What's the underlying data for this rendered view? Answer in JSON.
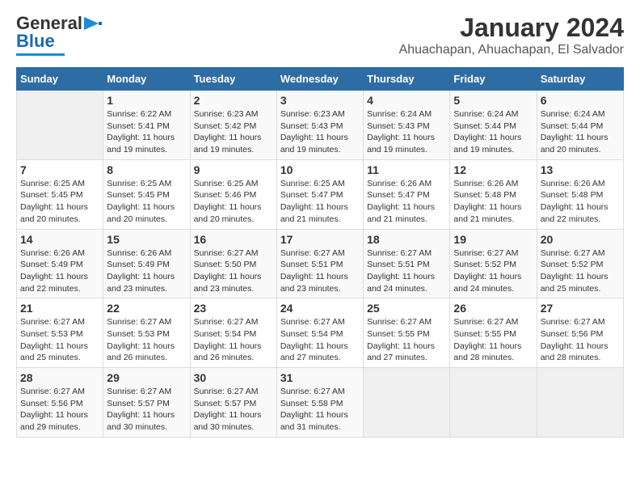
{
  "header": {
    "logo_line1": "General",
    "logo_line2": "Blue",
    "title": "January 2024",
    "subtitle": "Ahuachapan, Ahuachapan, El Salvador"
  },
  "days_of_week": [
    "Sunday",
    "Monday",
    "Tuesday",
    "Wednesday",
    "Thursday",
    "Friday",
    "Saturday"
  ],
  "weeks": [
    [
      {
        "day": "",
        "info": ""
      },
      {
        "day": "1",
        "info": "Sunrise: 6:22 AM\nSunset: 5:41 PM\nDaylight: 11 hours\nand 19 minutes."
      },
      {
        "day": "2",
        "info": "Sunrise: 6:23 AM\nSunset: 5:42 PM\nDaylight: 11 hours\nand 19 minutes."
      },
      {
        "day": "3",
        "info": "Sunrise: 6:23 AM\nSunset: 5:43 PM\nDaylight: 11 hours\nand 19 minutes."
      },
      {
        "day": "4",
        "info": "Sunrise: 6:24 AM\nSunset: 5:43 PM\nDaylight: 11 hours\nand 19 minutes."
      },
      {
        "day": "5",
        "info": "Sunrise: 6:24 AM\nSunset: 5:44 PM\nDaylight: 11 hours\nand 19 minutes."
      },
      {
        "day": "6",
        "info": "Sunrise: 6:24 AM\nSunset: 5:44 PM\nDaylight: 11 hours\nand 20 minutes."
      }
    ],
    [
      {
        "day": "7",
        "info": "Sunrise: 6:25 AM\nSunset: 5:45 PM\nDaylight: 11 hours\nand 20 minutes."
      },
      {
        "day": "8",
        "info": "Sunrise: 6:25 AM\nSunset: 5:45 PM\nDaylight: 11 hours\nand 20 minutes."
      },
      {
        "day": "9",
        "info": "Sunrise: 6:25 AM\nSunset: 5:46 PM\nDaylight: 11 hours\nand 20 minutes."
      },
      {
        "day": "10",
        "info": "Sunrise: 6:25 AM\nSunset: 5:47 PM\nDaylight: 11 hours\nand 21 minutes."
      },
      {
        "day": "11",
        "info": "Sunrise: 6:26 AM\nSunset: 5:47 PM\nDaylight: 11 hours\nand 21 minutes."
      },
      {
        "day": "12",
        "info": "Sunrise: 6:26 AM\nSunset: 5:48 PM\nDaylight: 11 hours\nand 21 minutes."
      },
      {
        "day": "13",
        "info": "Sunrise: 6:26 AM\nSunset: 5:48 PM\nDaylight: 11 hours\nand 22 minutes."
      }
    ],
    [
      {
        "day": "14",
        "info": "Sunrise: 6:26 AM\nSunset: 5:49 PM\nDaylight: 11 hours\nand 22 minutes."
      },
      {
        "day": "15",
        "info": "Sunrise: 6:26 AM\nSunset: 5:49 PM\nDaylight: 11 hours\nand 23 minutes."
      },
      {
        "day": "16",
        "info": "Sunrise: 6:27 AM\nSunset: 5:50 PM\nDaylight: 11 hours\nand 23 minutes."
      },
      {
        "day": "17",
        "info": "Sunrise: 6:27 AM\nSunset: 5:51 PM\nDaylight: 11 hours\nand 23 minutes."
      },
      {
        "day": "18",
        "info": "Sunrise: 6:27 AM\nSunset: 5:51 PM\nDaylight: 11 hours\nand 24 minutes."
      },
      {
        "day": "19",
        "info": "Sunrise: 6:27 AM\nSunset: 5:52 PM\nDaylight: 11 hours\nand 24 minutes."
      },
      {
        "day": "20",
        "info": "Sunrise: 6:27 AM\nSunset: 5:52 PM\nDaylight: 11 hours\nand 25 minutes."
      }
    ],
    [
      {
        "day": "21",
        "info": "Sunrise: 6:27 AM\nSunset: 5:53 PM\nDaylight: 11 hours\nand 25 minutes."
      },
      {
        "day": "22",
        "info": "Sunrise: 6:27 AM\nSunset: 5:53 PM\nDaylight: 11 hours\nand 26 minutes."
      },
      {
        "day": "23",
        "info": "Sunrise: 6:27 AM\nSunset: 5:54 PM\nDaylight: 11 hours\nand 26 minutes."
      },
      {
        "day": "24",
        "info": "Sunrise: 6:27 AM\nSunset: 5:54 PM\nDaylight: 11 hours\nand 27 minutes."
      },
      {
        "day": "25",
        "info": "Sunrise: 6:27 AM\nSunset: 5:55 PM\nDaylight: 11 hours\nand 27 minutes."
      },
      {
        "day": "26",
        "info": "Sunrise: 6:27 AM\nSunset: 5:55 PM\nDaylight: 11 hours\nand 28 minutes."
      },
      {
        "day": "27",
        "info": "Sunrise: 6:27 AM\nSunset: 5:56 PM\nDaylight: 11 hours\nand 28 minutes."
      }
    ],
    [
      {
        "day": "28",
        "info": "Sunrise: 6:27 AM\nSunset: 5:56 PM\nDaylight: 11 hours\nand 29 minutes."
      },
      {
        "day": "29",
        "info": "Sunrise: 6:27 AM\nSunset: 5:57 PM\nDaylight: 11 hours\nand 30 minutes."
      },
      {
        "day": "30",
        "info": "Sunrise: 6:27 AM\nSunset: 5:57 PM\nDaylight: 11 hours\nand 30 minutes."
      },
      {
        "day": "31",
        "info": "Sunrise: 6:27 AM\nSunset: 5:58 PM\nDaylight: 11 hours\nand 31 minutes."
      },
      {
        "day": "",
        "info": ""
      },
      {
        "day": "",
        "info": ""
      },
      {
        "day": "",
        "info": ""
      }
    ]
  ]
}
